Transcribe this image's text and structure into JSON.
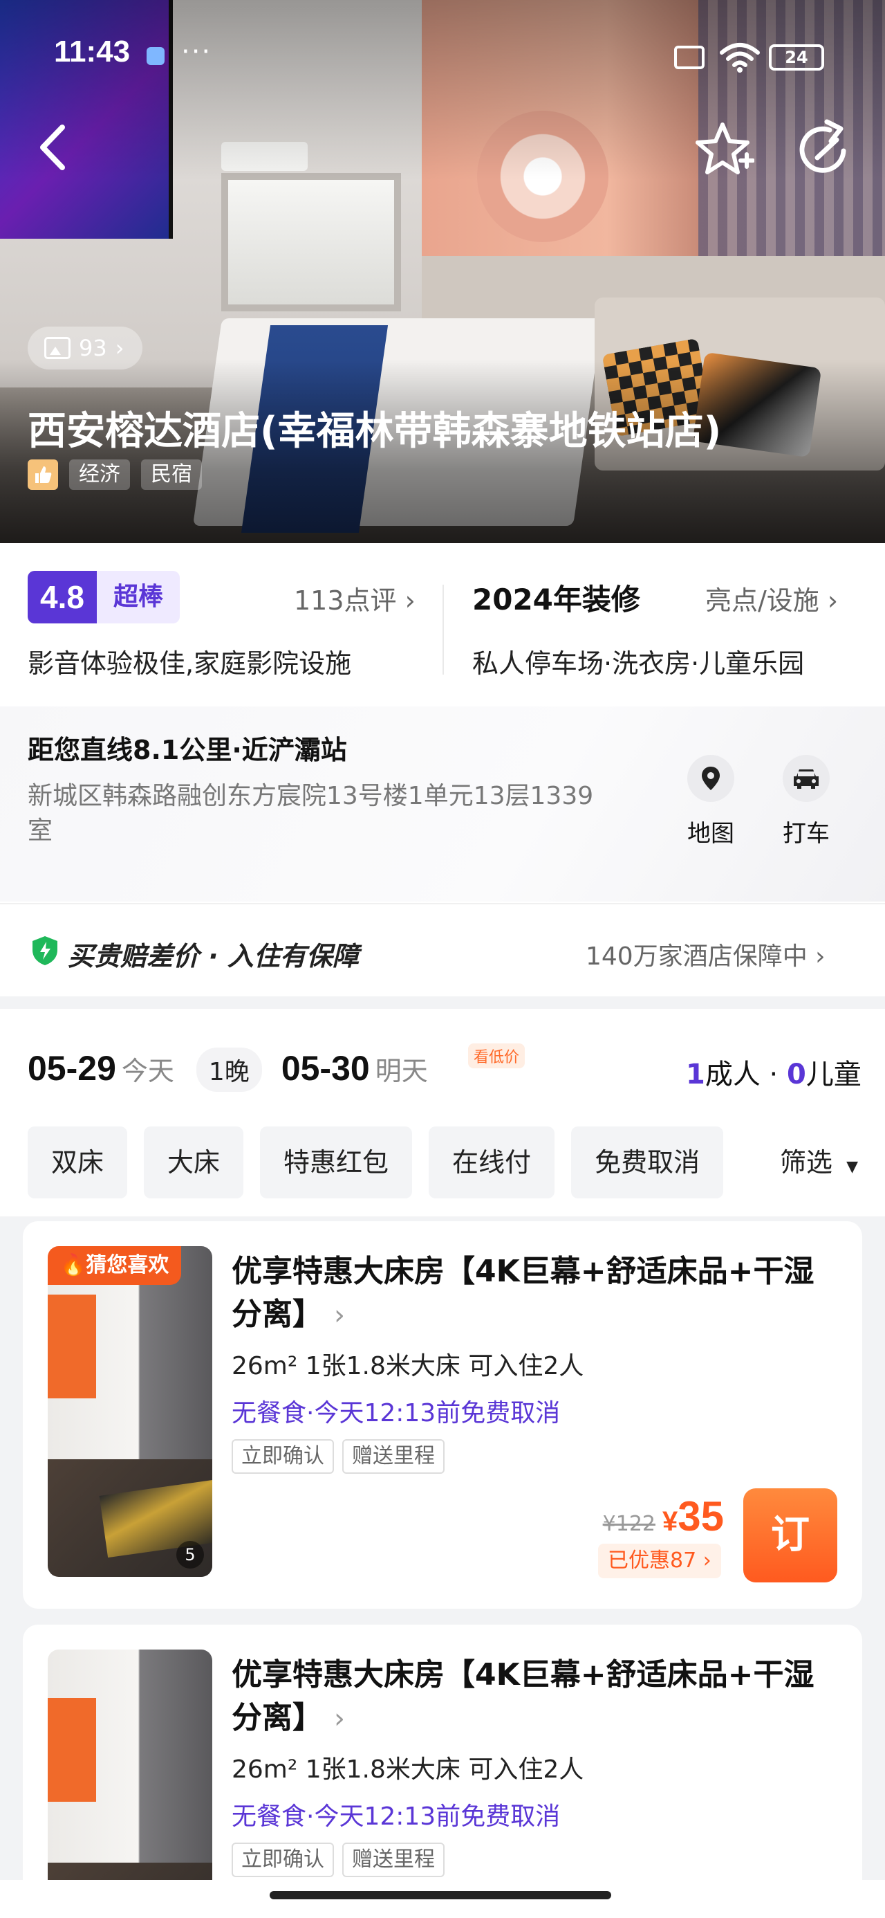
{
  "status_bar": {
    "time": "11:43",
    "dots": "···",
    "battery": "24"
  },
  "hero": {
    "photo_count": "93",
    "hotel_name": "西安榕达酒店(幸福林带韩森寨地铁站店)",
    "tags": [
      "经济",
      "民宿"
    ]
  },
  "rating": {
    "score": "4.8",
    "label": "超棒",
    "reviews": "113点评",
    "description": "影音体验极佳,家庭影院设施"
  },
  "renovation": {
    "year_label": "2024年装修",
    "highlights_link": "亮点/设施",
    "facilities": "私人停车场·洗衣房·儿童乐园"
  },
  "location": {
    "distance": "距您直线8.1公里·近浐灞站",
    "address": "新城区韩森路融创东方宸院13号楼1单元13层1339室",
    "map_label": "地图",
    "taxi_label": "打车"
  },
  "guarantee": {
    "title": "买贵赔差价 · 入住有保障",
    "right_text": "140万家酒店保障中"
  },
  "booking": {
    "checkin_date": "05-29",
    "checkin_day": "今天",
    "nights": "1晚",
    "checkout_date": "05-30",
    "checkout_day": "明天",
    "low_price_badge": "看低价",
    "adults_count": "1",
    "adults_label": "成人",
    "sep": " · ",
    "children_count": "0",
    "children_label": "儿童"
  },
  "filters": {
    "chips": [
      "双床",
      "大床",
      "特惠红包",
      "在线付",
      "免费取消"
    ],
    "more_label": "筛选"
  },
  "rooms": [
    {
      "badge": "猜您喜欢",
      "image_count": "5",
      "title": "优享特惠大床房【4K巨幕+舒适床品+干湿分离】",
      "spec": "26m²  1张1.8米大床  可入住2人",
      "policy": "无餐食·今天12:13前免费取消",
      "tags": [
        "立即确认",
        "赠送里程"
      ],
      "old_price": "¥122",
      "currency": "¥",
      "price": "35",
      "discount": "已优惠87",
      "book_label": "订"
    },
    {
      "title": "优享特惠大床房【4K巨幕+舒适床品+干湿分离】",
      "spec": "26m²  1张1.8米大床  可入住2人",
      "policy": "无餐食·今天12:13前免费取消",
      "tags": [
        "立即确认",
        "赠送里程"
      ]
    }
  ],
  "colors": {
    "brand_purple": "#5a36d6",
    "price_orange": "#ff5a1f",
    "guarantee_green": "#1fb85a"
  }
}
